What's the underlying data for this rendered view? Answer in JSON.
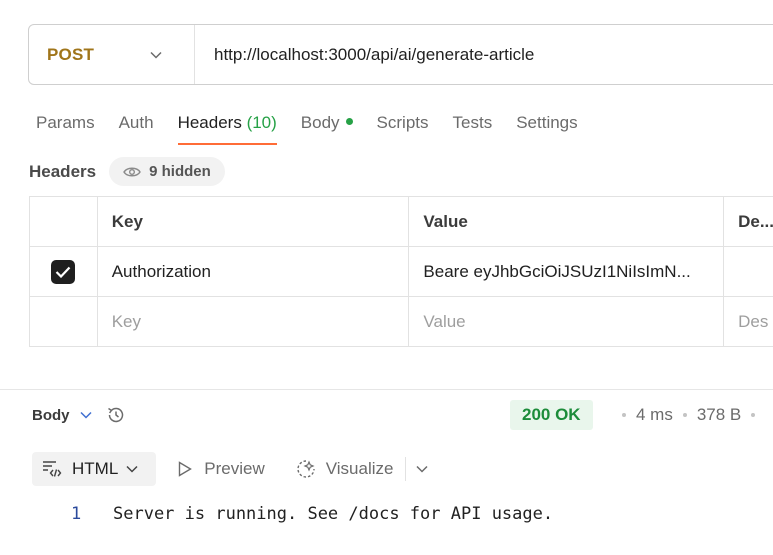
{
  "request": {
    "method": "POST",
    "url": "http://localhost:3000/api/ai/generate-article"
  },
  "tabs": [
    {
      "label": "Params"
    },
    {
      "label": "Auth"
    },
    {
      "label": "Headers",
      "count": "(10)"
    },
    {
      "label": "Body"
    },
    {
      "label": "Scripts"
    },
    {
      "label": "Tests"
    },
    {
      "label": "Settings"
    }
  ],
  "headers_section": {
    "title": "Headers",
    "hidden_label": "9 hidden",
    "columns": {
      "key": "Key",
      "value": "Value",
      "description": "De..."
    },
    "rows": [
      {
        "key": "Authorization",
        "value": "Beare eyJhbGciOiJSUzI1NiIsImN...",
        "description": "",
        "checked": true
      }
    ],
    "placeholder": {
      "key": "Key",
      "value": "Value",
      "description": "Des"
    }
  },
  "response": {
    "body_label": "Body",
    "status": "200 OK",
    "time": "4 ms",
    "size": "378 B",
    "format": "HTML",
    "preview_label": "Preview",
    "visualize_label": "Visualize",
    "lines": [
      {
        "no": "1",
        "text": "Server is running. See /docs for API usage."
      }
    ]
  },
  "colors": {
    "method": "#a0751a",
    "active_tab_underline": "#ff6c37",
    "success": "#26a146",
    "status_bg": "#e9f6ec"
  }
}
